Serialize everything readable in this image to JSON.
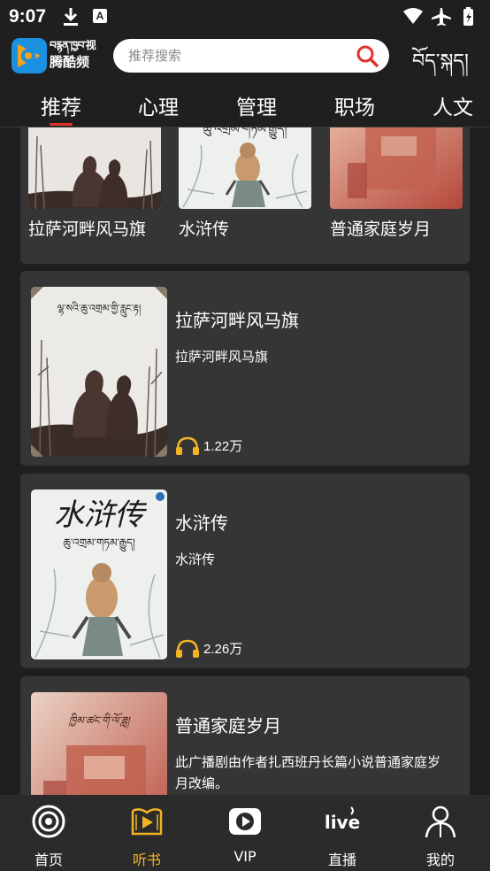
{
  "status_bar": {
    "time": "9:07",
    "keyboard_badge": "A"
  },
  "header": {
    "logo_line1": "བརྙན་ཁྱབ་视",
    "logo_line2": "腾酷频",
    "search_placeholder": "推荐搜索",
    "tibetan_label": "བོད་སྐད།"
  },
  "tabs": [
    {
      "label": "推荐",
      "active": true
    },
    {
      "label": "心理",
      "active": false
    },
    {
      "label": "管理",
      "active": false
    },
    {
      "label": "职场",
      "active": false
    },
    {
      "label": "人文",
      "active": false
    }
  ],
  "grid_items": [
    {
      "title": "拉萨河畔风马旗",
      "cover_text": ""
    },
    {
      "title": "水浒传",
      "cover_text": "ཆུ་འགྲམ་གཏམ་རྒྱུད།"
    },
    {
      "title": "普通家庭岁月",
      "cover_text": ""
    }
  ],
  "list_items": [
    {
      "title": "拉萨河畔风马旗",
      "desc": "拉萨河畔风马旗",
      "plays": "1.22万",
      "cover_title": "ལྷ་སའི་ཆུ་འགྲམ་གྱི་རླུང་རྟ།"
    },
    {
      "title": "水浒传",
      "desc": "水浒传",
      "plays": "2.26万",
      "cover_title": "水浒传",
      "cover_sub": "ཆུ་འགྲམ་གཏམ་རྒྱུད།"
    },
    {
      "title": "普通家庭岁月",
      "desc": " 此广播剧由作者扎西班丹长篇小说普通家庭岁月改编。",
      "plays": "",
      "cover_title": "ཁྱིམ་ཚང་གི་ལོ་ཟླ།"
    }
  ],
  "bottom_nav": [
    {
      "label": "首页",
      "icon": "home-icon",
      "active": false
    },
    {
      "label": "听书",
      "icon": "audiobook-icon",
      "active": true
    },
    {
      "label": "VIP",
      "icon": "vip-play-icon",
      "active": false
    },
    {
      "label": "直播",
      "icon": "live-icon",
      "active": false,
      "icon_text": "live"
    },
    {
      "label": "我的",
      "icon": "profile-icon",
      "active": false
    }
  ],
  "colors": {
    "accent_red": "#e0322c",
    "active_gold": "#f2b423",
    "card_bg": "#353535",
    "page_bg": "#1f1f1f"
  }
}
